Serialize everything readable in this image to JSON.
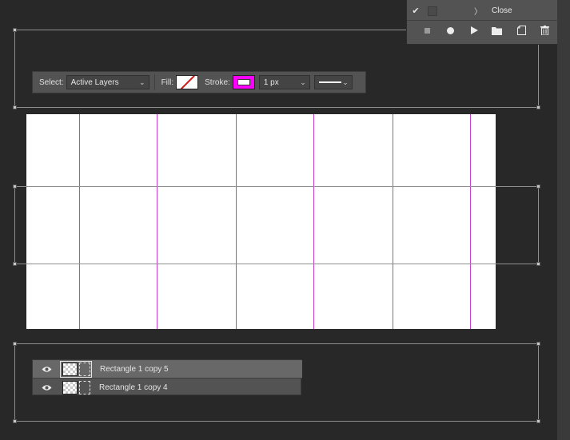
{
  "toolbar": {
    "select_label": "Select:",
    "select_value": "Active Layers",
    "fill_label": "Fill:",
    "stroke_label": "Stroke:",
    "stroke_width": "1 px",
    "fill_color": "#ffffff",
    "stroke_color": "#ff00ff"
  },
  "actions_panel": {
    "action_label": "Close",
    "buttons": [
      "stop-icon",
      "record-icon",
      "play-icon",
      "folder-icon",
      "new-action-icon",
      "trash-icon"
    ]
  },
  "layers": [
    {
      "name": "Rectangle 1 copy 5",
      "selected": true
    },
    {
      "name": "Rectangle 1 copy 4",
      "selected": false
    }
  ],
  "colors": {
    "guide": "#c93fd0",
    "canvas": "#ffffff",
    "workspace": "#282828",
    "panel": "#535353"
  }
}
